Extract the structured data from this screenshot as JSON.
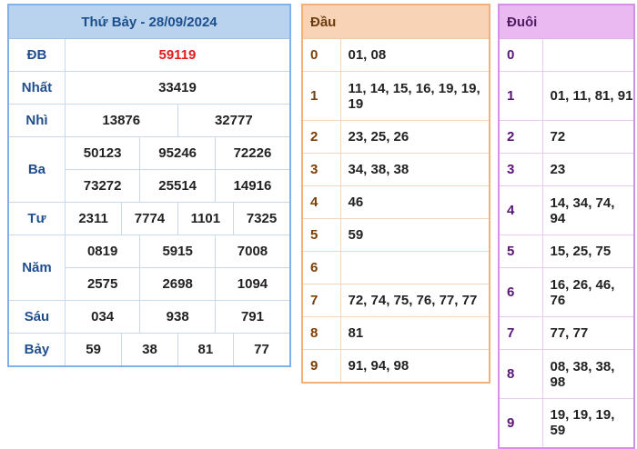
{
  "results": {
    "title": "Thứ Bảy - 28/09/2024",
    "labels": {
      "db": "ĐB",
      "nhat": "Nhất",
      "nhi": "Nhì",
      "ba": "Ba",
      "tu": "Tư",
      "nam": "Năm",
      "sau": "Sáu",
      "bay": "Bảy"
    },
    "db": "59119",
    "nhat": "33419",
    "nhi": [
      "13876",
      "32777"
    ],
    "ba": [
      "50123",
      "95246",
      "72226",
      "73272",
      "25514",
      "14916"
    ],
    "tu": [
      "2311",
      "7774",
      "1101",
      "7325"
    ],
    "nam": [
      "0819",
      "5915",
      "7008",
      "2575",
      "2698",
      "1094"
    ],
    "sau": [
      "034",
      "938",
      "791"
    ],
    "bay": [
      "59",
      "38",
      "81",
      "77"
    ],
    "accent_red": "#e31b1b"
  },
  "dau": {
    "header": "Đầu",
    "rows": [
      {
        "k": "0",
        "v": "01, 08"
      },
      {
        "k": "1",
        "v": "11, 14, 15, 16, 19, 19, 19"
      },
      {
        "k": "2",
        "v": "23, 25, 26"
      },
      {
        "k": "3",
        "v": "34, 38, 38"
      },
      {
        "k": "4",
        "v": "46"
      },
      {
        "k": "5",
        "v": "59"
      },
      {
        "k": "6",
        "v": ""
      },
      {
        "k": "7",
        "v": "72, 74, 75, 76, 77, 77"
      },
      {
        "k": "8",
        "v": "81"
      },
      {
        "k": "9",
        "v": "91, 94, 98"
      }
    ]
  },
  "duoi": {
    "header": "Đuôi",
    "rows": [
      {
        "k": "0",
        "v": ""
      },
      {
        "k": "1",
        "v": "01, 11, 81, 91"
      },
      {
        "k": "2",
        "v": "72"
      },
      {
        "k": "3",
        "v": "23"
      },
      {
        "k": "4",
        "v": "14, 34, 74, 94"
      },
      {
        "k": "5",
        "v": "15, 25, 75"
      },
      {
        "k": "6",
        "v": "16, 26, 46, 76"
      },
      {
        "k": "7",
        "v": "77, 77"
      },
      {
        "k": "8",
        "v": "08, 38, 38, 98"
      },
      {
        "k": "9",
        "v": "19, 19, 19, 59"
      }
    ]
  }
}
